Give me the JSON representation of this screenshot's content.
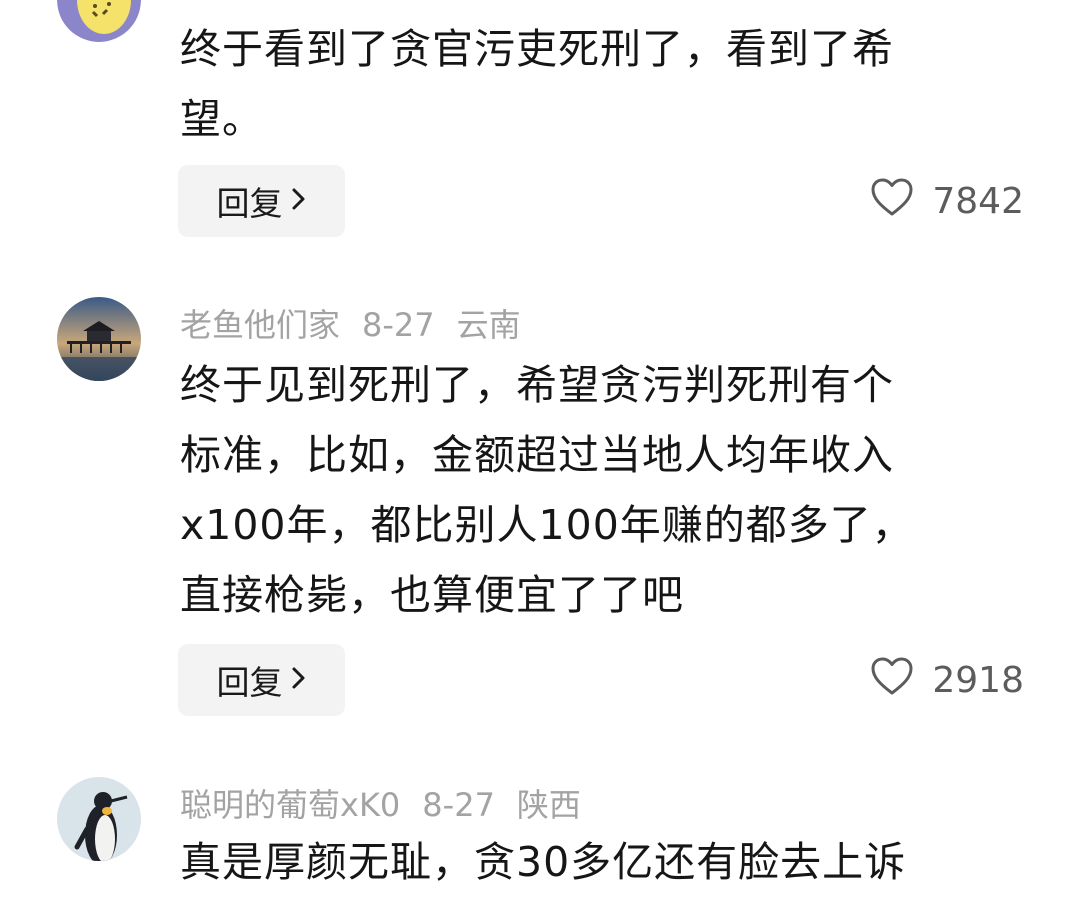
{
  "comments": [
    {
      "user": "",
      "date": "",
      "location": "",
      "text_lines": [
        "终于看到了贪官污吏死刑了，看到了希",
        "望。"
      ],
      "reply_label": "回复",
      "like_count": "7842"
    },
    {
      "user": "老鱼他们家",
      "date": "8-27",
      "location": "云南",
      "text_lines": [
        "终于见到死刑了，希望贪污判死刑有个",
        "标准，比如，金额超过当地人均年收入",
        "x100年，都比别人100年赚的都多了，",
        "直接枪毙，也算便宜了了吧"
      ],
      "reply_label": "回复",
      "like_count": "2918"
    },
    {
      "user": "聪明的葡萄xK0",
      "date": "8-27",
      "location": "陕西",
      "text_lines": [
        "真是厚颜无耻，贪30多亿还有脸去上诉"
      ],
      "reply_label": "",
      "like_count": ""
    }
  ],
  "icons": {
    "heart": "heart-outline-icon",
    "chevron": "chevron-right-icon"
  },
  "colors": {
    "meta_text": "#a3a3a3",
    "button_bg": "#f3f3f3",
    "like_text": "#5c5c5c"
  }
}
